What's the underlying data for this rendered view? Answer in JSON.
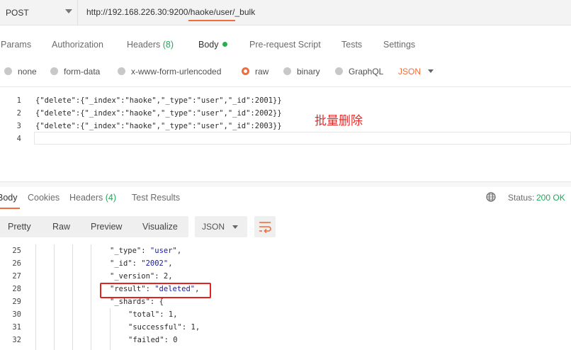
{
  "request": {
    "method": "POST",
    "url": "http://192.168.226.30:9200/haoke/user/_bulk"
  },
  "request_tabs": [
    {
      "label": "Params"
    },
    {
      "label": "Authorization"
    },
    {
      "label": "Headers",
      "count": "(8)"
    },
    {
      "label": "Body"
    },
    {
      "label": "Pre-request Script"
    },
    {
      "label": "Tests"
    },
    {
      "label": "Settings"
    }
  ],
  "body_types": [
    {
      "label": "none"
    },
    {
      "label": "form-data"
    },
    {
      "label": "x-www-form-urlencoded"
    },
    {
      "label": "raw"
    },
    {
      "label": "binary"
    },
    {
      "label": "GraphQL"
    }
  ],
  "body_format": "JSON",
  "editor_lines": [
    {
      "num": "1",
      "code": "{\"delete\":{\"_index\":\"haoke\",\"_type\":\"user\",\"_id\":2001}}"
    },
    {
      "num": "2",
      "code": "{\"delete\":{\"_index\":\"haoke\",\"_type\":\"user\",\"_id\":2002}}"
    },
    {
      "num": "3",
      "code": "{\"delete\":{\"_index\":\"haoke\",\"_type\":\"user\",\"_id\":2003}}"
    },
    {
      "num": "4",
      "code": ""
    }
  ],
  "annotation": "批量删除",
  "response_tabs": [
    {
      "label": "Body"
    },
    {
      "label": "Cookies"
    },
    {
      "label": "Headers",
      "count": "(4)"
    },
    {
      "label": "Test Results"
    }
  ],
  "status": {
    "label": "Status:",
    "value": "200 OK"
  },
  "view_modes": [
    "Pretty",
    "Raw",
    "Preview",
    "Visualize"
  ],
  "response_format": "JSON",
  "response_lines": [
    {
      "num": "25",
      "key": "\"_type\"",
      "sep": ": ",
      "val": "\"user\"",
      "tail": ","
    },
    {
      "num": "26",
      "key": "\"_id\"",
      "sep": ": ",
      "val": "\"2002\"",
      "tail": ","
    },
    {
      "num": "27",
      "key": "\"_version\"",
      "sep": ": ",
      "val": "2",
      "tail": ","
    },
    {
      "num": "28",
      "key": "\"result\"",
      "sep": ": ",
      "val": "\"deleted\"",
      "tail": ","
    },
    {
      "num": "29",
      "key": "\"_shards\"",
      "sep": ": ",
      "val": "{",
      "tail": ""
    },
    {
      "num": "30",
      "key": "\"total\"",
      "sep": ": ",
      "val": "1",
      "tail": ","
    },
    {
      "num": "31",
      "key": "\"successful\"",
      "sep": ": ",
      "val": "1",
      "tail": ","
    },
    {
      "num": "32",
      "key": "\"failed\"",
      "sep": ": ",
      "val": "0",
      "tail": ""
    }
  ],
  "colors": {
    "accent": "#f26b3a",
    "success": "#26a65b",
    "annotation": "#e52b2b"
  }
}
